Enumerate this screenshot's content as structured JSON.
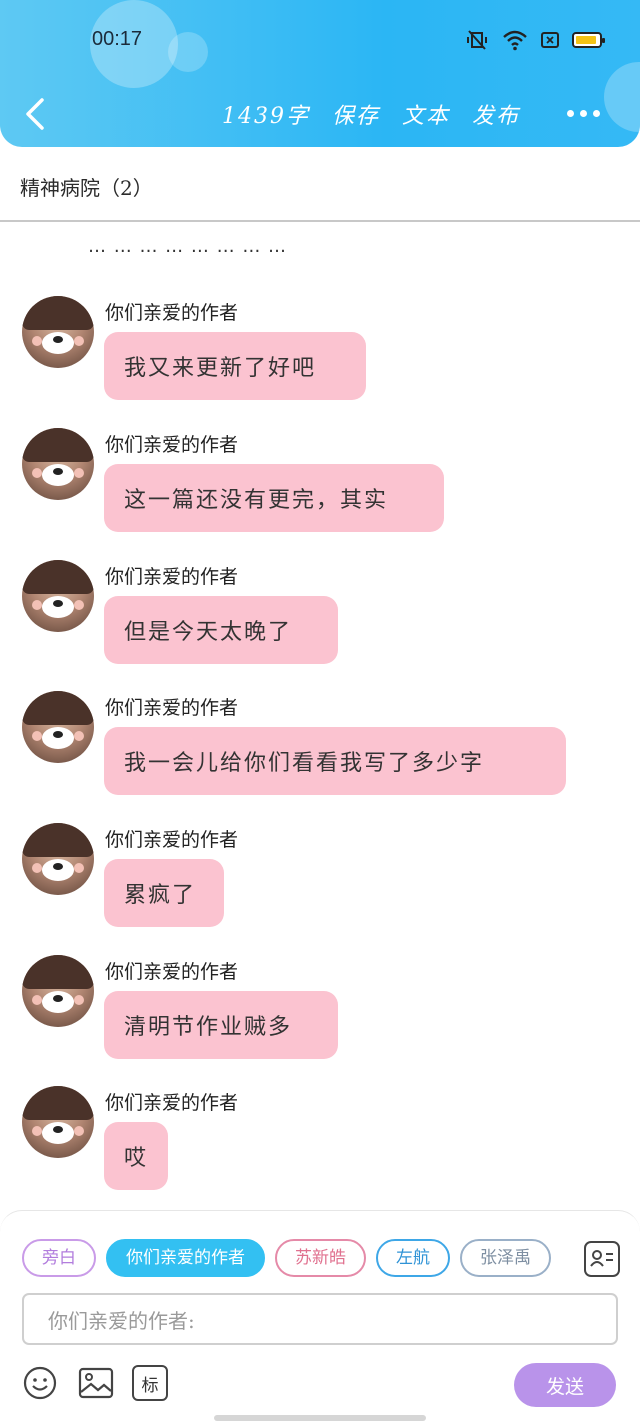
{
  "status_bar": {
    "time": "00:17"
  },
  "header": {
    "word_count": "1439字",
    "actions": [
      "保存",
      "文本",
      "发布"
    ]
  },
  "title": "精神病院（2）",
  "ellipsis": "… … … … … … … …",
  "messages": [
    {
      "sender": "你们亲爱的作者",
      "text": "我又来更新了好吧"
    },
    {
      "sender": "你们亲爱的作者",
      "text": "这一篇还没有更完，其实"
    },
    {
      "sender": "你们亲爱的作者",
      "text": "但是今天太晚了"
    },
    {
      "sender": "你们亲爱的作者",
      "text": "我一会儿给你们看看我写了多少字"
    },
    {
      "sender": "你们亲爱的作者",
      "text": "累疯了"
    },
    {
      "sender": "你们亲爱的作者",
      "text": "清明节作业贼多"
    },
    {
      "sender": "你们亲爱的作者",
      "text": "哎"
    }
  ],
  "role_chips": [
    "旁白",
    "你们亲爱的作者",
    "苏新皓",
    "左航",
    "张泽禹"
  ],
  "input": {
    "placeholder": "你们亲爱的作者:"
  },
  "toolbar": {
    "mark_label": "标",
    "send_label": "发送"
  },
  "colors": {
    "header": "#2bb6f4",
    "bubble": "#fbc3d0",
    "send": "#b993ea",
    "active_chip": "#33c0f2"
  }
}
